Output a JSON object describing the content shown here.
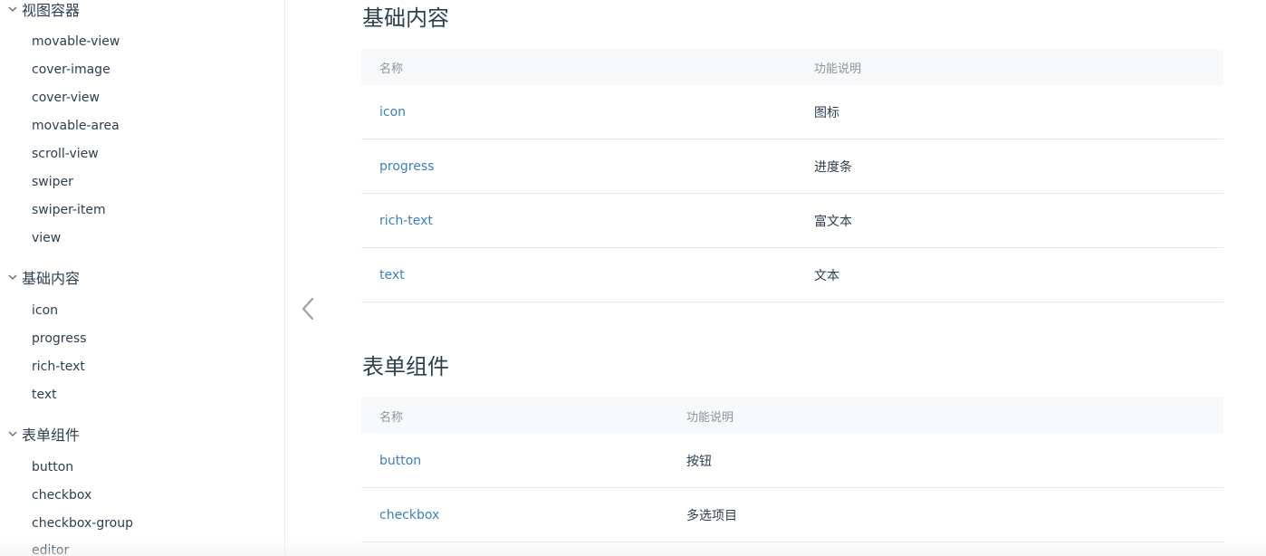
{
  "sidebar": {
    "groups": [
      {
        "title": "视图容器",
        "items": [
          "movable-view",
          "cover-image",
          "cover-view",
          "movable-area",
          "scroll-view",
          "swiper",
          "swiper-item",
          "view"
        ]
      },
      {
        "title": "基础内容",
        "items": [
          "icon",
          "progress",
          "rich-text",
          "text"
        ]
      },
      {
        "title": "表单组件",
        "items": [
          "button",
          "checkbox",
          "checkbox-group",
          "editor"
        ]
      }
    ]
  },
  "sections": [
    {
      "title": "基础内容",
      "header": {
        "name": "名称",
        "desc": "功能说明"
      },
      "rows": [
        {
          "name": "icon",
          "desc": "图标"
        },
        {
          "name": "progress",
          "desc": "进度条"
        },
        {
          "name": "rich-text",
          "desc": "富文本"
        },
        {
          "name": "text",
          "desc": "文本"
        }
      ]
    },
    {
      "title": "表单组件",
      "header": {
        "name": "名称",
        "desc": "功能说明"
      },
      "rows": [
        {
          "name": "button",
          "desc": "按钮"
        },
        {
          "name": "checkbox",
          "desc": "多选项目"
        }
      ]
    }
  ],
  "icons": {
    "group_toggle": "chevron-down-icon",
    "collapse": "chevron-left-icon"
  },
  "colors": {
    "link": "#3a7fc0",
    "text": "#2c3e50",
    "header_bg": "#f6f8fa",
    "border": "#e4e7ed"
  }
}
